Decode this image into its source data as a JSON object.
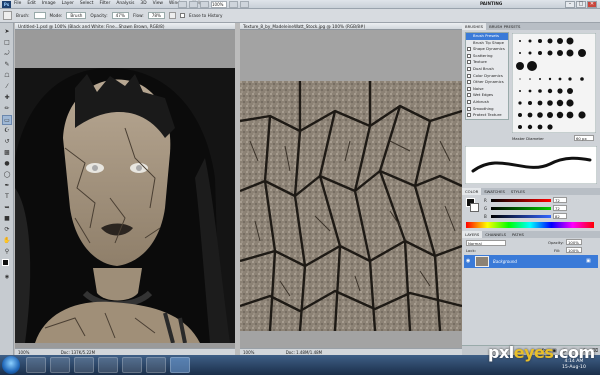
{
  "app": {
    "logo": "Ps",
    "menu": [
      "File",
      "Edit",
      "Image",
      "Layer",
      "Select",
      "Filter",
      "Analysis",
      "3D",
      "View",
      "Window",
      "Help"
    ],
    "zoom": "100%",
    "workspace": "PAINTING",
    "controls": [
      "–",
      "□",
      "✕"
    ]
  },
  "options": {
    "brush_label": "Brush:",
    "mode_label": "Mode:",
    "mode_value": "Brush",
    "opacity_label": "Opacity:",
    "opacity_value": "47%",
    "flow_label": "Flow:",
    "flow_value": "78%",
    "erase_to_history": "Erase to History"
  },
  "doc1": {
    "title": "Untitled-1.psd @ 100% (Black and White: Fine...Shawn Brown, RGB/8)",
    "zoom": "100%",
    "doc_size": "Doc: 137K/5.22M"
  },
  "doc2": {
    "title": "Texture_8_by_MadeleineWatt_Stock.jpg @ 100% (RGB/8#)",
    "zoom": "100%",
    "doc_size": "Doc: 1.48M/1.48M"
  },
  "brushes": {
    "tabs": [
      "BRUSHES",
      "BRUSH PRESETS"
    ],
    "presets_label": "Brush Presets",
    "tip_shape": "Brush Tip Shape",
    "options": [
      "Shape Dynamics",
      "Scattering",
      "Texture",
      "Dual Brush",
      "Color Dynamics",
      "Other Dynamics",
      "Noise",
      "Wet Edges",
      "Airbrush",
      "Smoothing",
      "Protect Texture"
    ],
    "master_diameter_label": "Master Diameter",
    "master_diameter_value": "60 px"
  },
  "color": {
    "tabs": [
      "COLOR",
      "SWATCHES",
      "STYLES"
    ],
    "channels": [
      {
        "name": "R",
        "value": "72",
        "color": "#d24a4a"
      },
      {
        "name": "G",
        "value": "72",
        "color": "#3aa14a"
      },
      {
        "name": "B",
        "value": "82",
        "color": "#3f63d0"
      }
    ]
  },
  "layers": {
    "tabs": [
      "LAYERS",
      "CHANNELS",
      "PATHS"
    ],
    "blend_mode": "Normal",
    "opacity_label": "Opacity:",
    "opacity_value": "100%",
    "lock_label": "Lock:",
    "fill_label": "Fill:",
    "fill_value": "100%",
    "items": [
      {
        "name": "Background"
      }
    ]
  },
  "taskbar": {
    "time": "4:14 AM",
    "date": "15-Aug-10"
  },
  "watermark": {
    "part1": "pxl",
    "part2": "eyes",
    "part3": ".com"
  },
  "colors": {
    "selection": "#3a7ad8",
    "canvas": "#9a9a9a"
  }
}
